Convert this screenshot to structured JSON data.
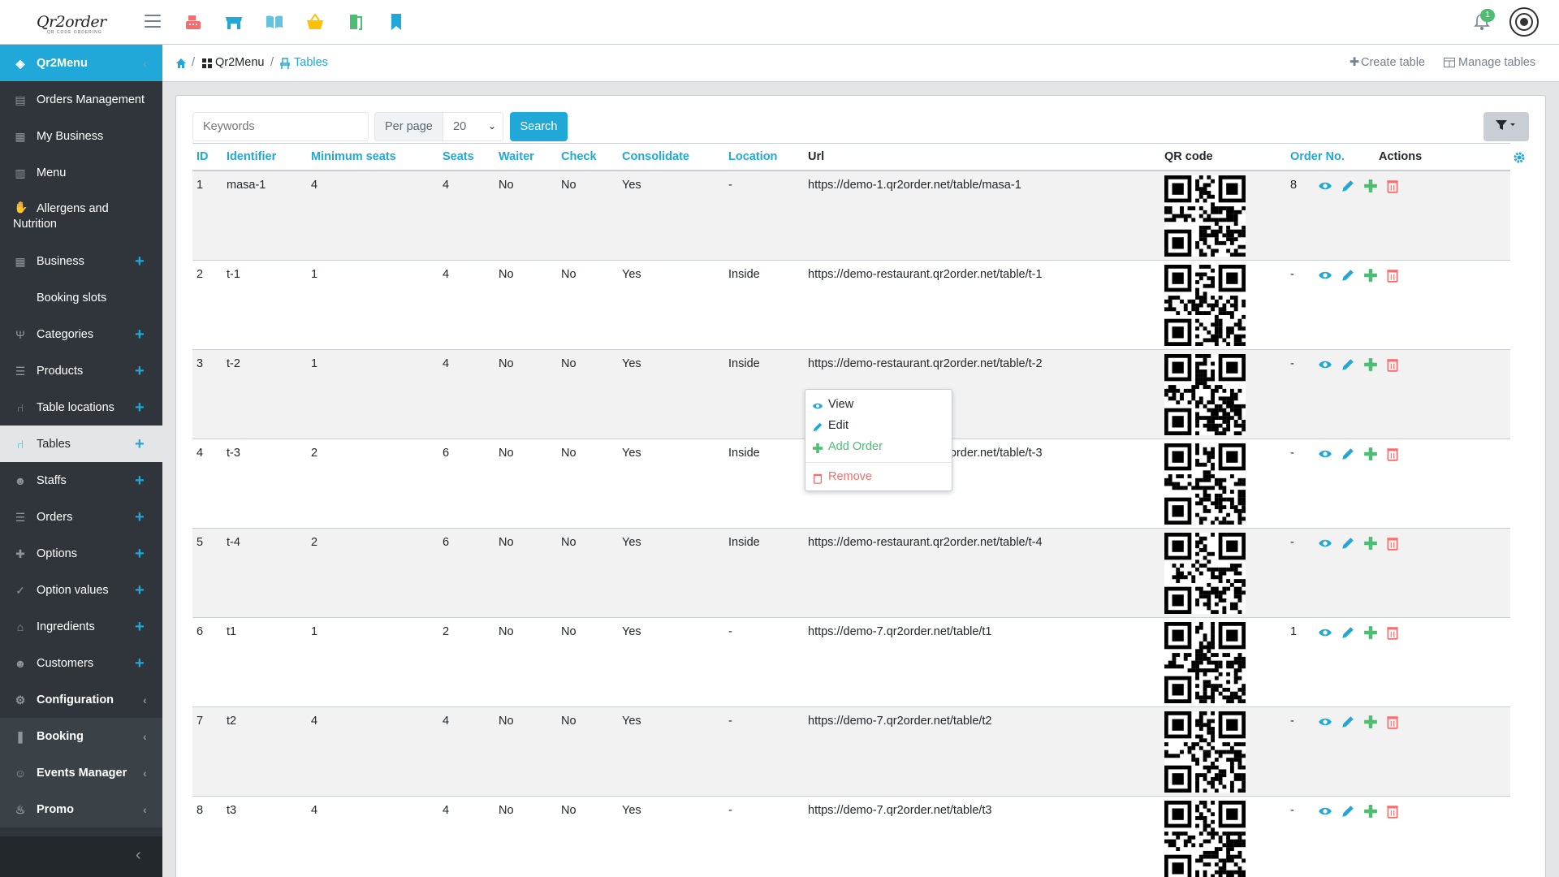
{
  "app": {
    "logo_text": "Qr2order",
    "logo_tagline": "QR CODE ORDERING",
    "notification_count": "1"
  },
  "sidebar": {
    "items": [
      {
        "label": "Qr2Menu",
        "icon": "dashboard-icon"
      },
      {
        "label": "Orders Management",
        "icon": "cash-register-icon"
      },
      {
        "label": "My Business",
        "icon": "store-icon"
      },
      {
        "label": "Menu",
        "icon": "book-open-icon"
      },
      {
        "label": "Allergens and",
        "label2": "Nutrition",
        "icon": "hand-icon"
      },
      {
        "label": "Business",
        "icon": "store-icon"
      },
      {
        "label": "Booking slots",
        "icon": ""
      },
      {
        "label": "Categories",
        "icon": "utensils-icon"
      },
      {
        "label": "Products",
        "icon": "list-icon"
      },
      {
        "label": "Table locations",
        "icon": "chair-icon"
      },
      {
        "label": "Tables",
        "icon": "chair-icon"
      },
      {
        "label": "Staffs",
        "icon": "users-icon"
      },
      {
        "label": "Orders",
        "icon": "list-icon"
      },
      {
        "label": "Options",
        "icon": "puzzle-icon"
      },
      {
        "label": "Option values",
        "icon": "check-circle-icon"
      },
      {
        "label": "Ingredients",
        "icon": "basket-icon"
      },
      {
        "label": "Customers",
        "icon": "users-icon"
      },
      {
        "label": "Configuration",
        "icon": "cogs-icon"
      },
      {
        "label": "Booking",
        "icon": "bookmark-icon"
      },
      {
        "label": "Events Manager",
        "icon": "theater-icon"
      },
      {
        "label": "Promo",
        "icon": "fire-icon"
      }
    ]
  },
  "breadcrumb": {
    "home_icon": "home-icon",
    "parent": "Qr2Menu",
    "current": "Tables",
    "create_label": "Create table",
    "manage_label": "Manage tables"
  },
  "toolbar": {
    "keywords_placeholder": "Keywords",
    "per_page_label": "Per page",
    "per_page_value": "20",
    "search_label": "Search"
  },
  "table": {
    "headers": [
      "ID",
      "Identifier",
      "Minimum seats",
      "Seats",
      "Waiter",
      "Check",
      "Consolidate",
      "Location",
      "Url",
      "QR code",
      "Order No.",
      "Actions"
    ],
    "rows": [
      {
        "id": "1",
        "identifier": "masa-1",
        "min_seats": "4",
        "seats": "4",
        "waiter": "No",
        "check": "No",
        "consolidate": "Yes",
        "location": "-",
        "url": "https://demo-1.qr2order.net/table/masa-1",
        "order_no": "8"
      },
      {
        "id": "2",
        "identifier": "t-1",
        "min_seats": "1",
        "seats": "4",
        "waiter": "No",
        "check": "No",
        "consolidate": "Yes",
        "location": "Inside",
        "url": "https://demo-restaurant.qr2order.net/table/t-1",
        "order_no": "-"
      },
      {
        "id": "3",
        "identifier": "t-2",
        "min_seats": "1",
        "seats": "4",
        "waiter": "No",
        "check": "No",
        "consolidate": "Yes",
        "location": "Inside",
        "url": "https://demo-restaurant.qr2order.net/table/t-2",
        "order_no": "-"
      },
      {
        "id": "4",
        "identifier": "t-3",
        "min_seats": "2",
        "seats": "6",
        "waiter": "No",
        "check": "No",
        "consolidate": "Yes",
        "location": "Inside",
        "url": "https://demo-restaurant.qr2order.net/table/t-3",
        "order_no": "-"
      },
      {
        "id": "5",
        "identifier": "t-4",
        "min_seats": "2",
        "seats": "6",
        "waiter": "No",
        "check": "No",
        "consolidate": "Yes",
        "location": "Inside",
        "url": "https://demo-restaurant.qr2order.net/table/t-4",
        "order_no": "-"
      },
      {
        "id": "6",
        "identifier": "t1",
        "min_seats": "1",
        "seats": "2",
        "waiter": "No",
        "check": "No",
        "consolidate": "Yes",
        "location": "-",
        "url": "https://demo-7.qr2order.net/table/t1",
        "order_no": "1"
      },
      {
        "id": "7",
        "identifier": "t2",
        "min_seats": "4",
        "seats": "4",
        "waiter": "No",
        "check": "No",
        "consolidate": "Yes",
        "location": "-",
        "url": "https://demo-7.qr2order.net/table/t2",
        "order_no": "-"
      },
      {
        "id": "8",
        "identifier": "t3",
        "min_seats": "4",
        "seats": "4",
        "waiter": "No",
        "check": "No",
        "consolidate": "Yes",
        "location": "-",
        "url": "https://demo-7.qr2order.net/table/t3",
        "order_no": "-"
      }
    ]
  },
  "context_menu": {
    "view": "View",
    "edit": "Edit",
    "add_order": "Add Order",
    "remove": "Remove"
  },
  "colors": {
    "primary": "#20a8d8",
    "success": "#4dbd74",
    "danger": "#f86c6b",
    "sidebar": "#2f353a"
  }
}
